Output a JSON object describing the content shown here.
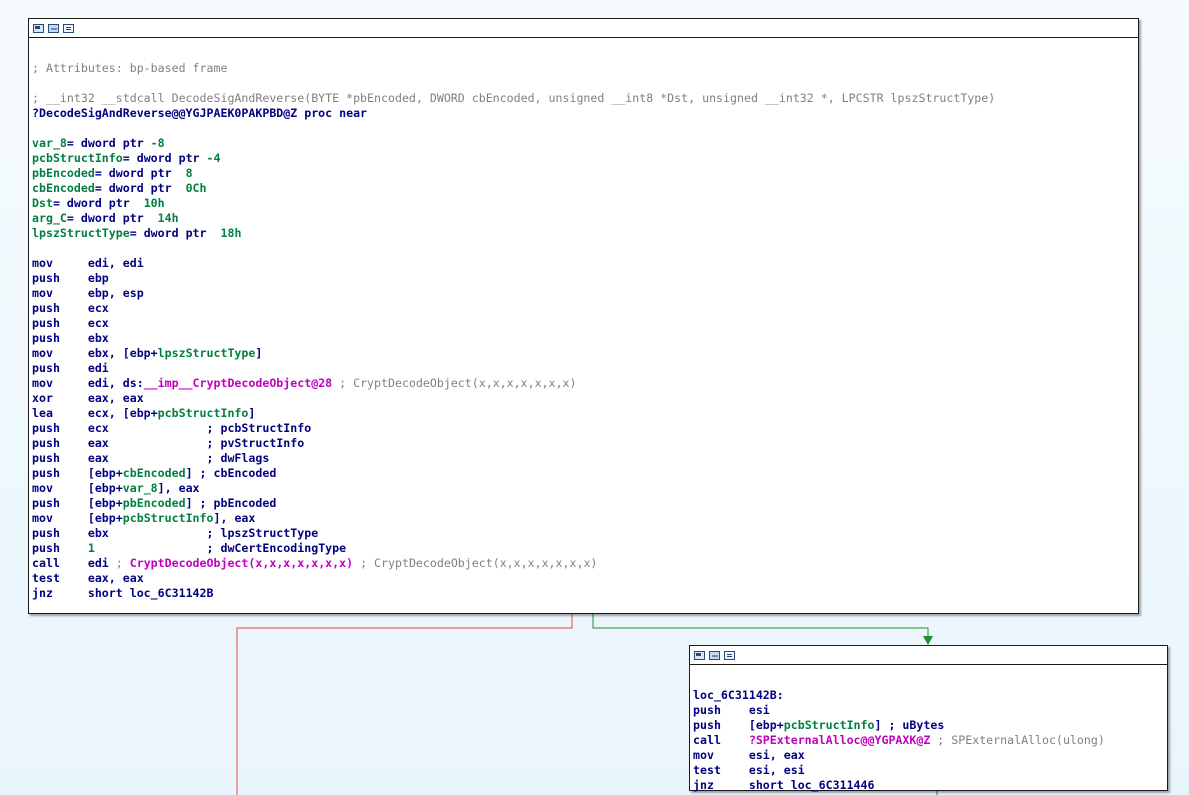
{
  "colors": {
    "edge_false": "#e84a4a",
    "edge_true": "#1e8e2e",
    "name": "#008040",
    "func": "#c000c0",
    "comment": "#808080",
    "code": "#000080"
  },
  "header_icons": [
    "graph-view-icon",
    "image-icon",
    "window-icon"
  ],
  "block1": {
    "lines": [
      "",
      "; Attributes: bp-based frame",
      "",
      "; __int32 __stdcall DecodeSigAndReverse(BYTE *pbEncoded, DWORD cbEncoded, unsigned __int8 *Dst, unsigned __int32 *, LPCSTR lpszStructType)",
      "?DecodeSigAndReverse@@YGJPAEK0PAKPBD@Z proc near",
      "",
      {
        "n": "var_8",
        "t": "= dword ptr ",
        "v": "-8"
      },
      {
        "n": "pcbStructInfo",
        "t": "= dword ptr ",
        "v": "-4"
      },
      {
        "n": "pbEncoded",
        "t": "= dword ptr  ",
        "v": "8"
      },
      {
        "n": "cbEncoded",
        "t": "= dword ptr  ",
        "v": "0Ch"
      },
      {
        "n": "Dst",
        "t": "= dword ptr  ",
        "v": "10h"
      },
      {
        "n": "arg_C",
        "t": "= dword ptr  ",
        "v": "14h"
      },
      {
        "n": "lpszStructType",
        "t": "= dword ptr  ",
        "v": "18h"
      },
      ""
    ],
    "instructions": [
      {
        "m": "mov",
        "o": [
          [
            "p",
            "edi, edi"
          ]
        ]
      },
      {
        "m": "push",
        "o": [
          [
            "p",
            "ebp"
          ]
        ]
      },
      {
        "m": "mov",
        "o": [
          [
            "p",
            "ebp, esp"
          ]
        ]
      },
      {
        "m": "push",
        "o": [
          [
            "p",
            "ecx"
          ]
        ]
      },
      {
        "m": "push",
        "o": [
          [
            "p",
            "ecx"
          ]
        ]
      },
      {
        "m": "push",
        "o": [
          [
            "p",
            "ebx"
          ]
        ]
      },
      {
        "m": "mov",
        "o": [
          [
            "p",
            "ebx, [ebp+"
          ],
          [
            "n",
            "lpszStructType"
          ],
          [
            "p",
            "]"
          ]
        ]
      },
      {
        "m": "push",
        "o": [
          [
            "p",
            "edi"
          ]
        ]
      },
      {
        "m": "mov",
        "o": [
          [
            "p",
            "edi, ds:"
          ],
          [
            "f",
            "__imp__CryptDecodeObject@28"
          ],
          [
            "c",
            " ; CryptDecodeObject(x,x,x,x,x,x,x)"
          ]
        ]
      },
      {
        "m": "xor",
        "o": [
          [
            "p",
            "eax, eax"
          ]
        ]
      },
      {
        "m": "lea",
        "o": [
          [
            "p",
            "ecx, [ebp+"
          ],
          [
            "n",
            "pcbStructInfo"
          ],
          [
            "p",
            "]"
          ]
        ]
      },
      {
        "m": "push",
        "o": [
          [
            "p",
            "ecx              ; pcbStructInfo"
          ]
        ]
      },
      {
        "m": "push",
        "o": [
          [
            "p",
            "eax              ; pvStructInfo"
          ]
        ]
      },
      {
        "m": "push",
        "o": [
          [
            "p",
            "eax              ; dwFlags"
          ]
        ]
      },
      {
        "m": "push",
        "o": [
          [
            "p",
            "[ebp+"
          ],
          [
            "n",
            "cbEncoded"
          ],
          [
            "p",
            "] ; cbEncoded"
          ]
        ]
      },
      {
        "m": "mov",
        "o": [
          [
            "p",
            "[ebp+"
          ],
          [
            "n",
            "var_8"
          ],
          [
            "p",
            "], eax"
          ]
        ]
      },
      {
        "m": "push",
        "o": [
          [
            "p",
            "[ebp+"
          ],
          [
            "n",
            "pbEncoded"
          ],
          [
            "p",
            "] ; pbEncoded"
          ]
        ]
      },
      {
        "m": "mov",
        "o": [
          [
            "p",
            "[ebp+"
          ],
          [
            "n",
            "pcbStructInfo"
          ],
          [
            "p",
            "], eax"
          ]
        ]
      },
      {
        "m": "push",
        "o": [
          [
            "p",
            "ebx              ; lpszStructType"
          ]
        ]
      },
      {
        "m": "push",
        "o": [
          [
            "v",
            "1"
          ],
          [
            "p",
            "                ; dwCertEncodingType"
          ]
        ]
      },
      {
        "m": "call",
        "o": [
          [
            "p",
            "edi "
          ],
          [
            "c",
            "; "
          ],
          [
            "f",
            "CryptDecodeObject(x,x,x,x,x,x,x)"
          ],
          [
            "c",
            " ; CryptDecodeObject(x,x,x,x,x,x,x)"
          ]
        ]
      },
      {
        "m": "test",
        "o": [
          [
            "p",
            "eax, eax"
          ]
        ]
      },
      {
        "m": "jnz",
        "o": [
          [
            "p",
            "short loc_6C31142B"
          ]
        ]
      }
    ]
  },
  "block2": {
    "lines": [
      "",
      "loc_6C31142B:"
    ],
    "instructions": [
      {
        "m": "push",
        "o": [
          [
            "p",
            "esi"
          ]
        ]
      },
      {
        "m": "push",
        "o": [
          [
            "p",
            "[ebp+"
          ],
          [
            "n",
            "pcbStructInfo"
          ],
          [
            "p",
            "] ; uBytes"
          ]
        ]
      },
      {
        "m": "call",
        "o": [
          [
            "f",
            "?SPExternalAlloc@@YGPAXK@Z"
          ],
          [
            "c",
            " ; SPExternalAlloc(ulong)"
          ]
        ]
      },
      {
        "m": "mov",
        "o": [
          [
            "p",
            "esi, eax"
          ]
        ]
      },
      {
        "m": "test",
        "o": [
          [
            "p",
            "esi, esi"
          ]
        ]
      },
      {
        "m": "jnz",
        "o": [
          [
            "p",
            "short loc_6C311446"
          ]
        ]
      }
    ]
  }
}
